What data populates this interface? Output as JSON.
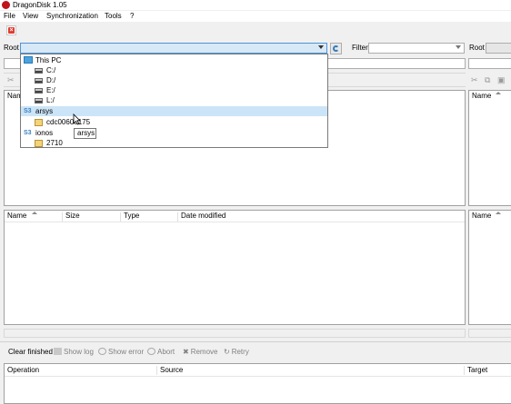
{
  "window": {
    "title": "DragonDisk 1.05"
  },
  "menu": [
    "File",
    "View",
    "Synchronization",
    "Tools",
    "?"
  ],
  "left_pane": {
    "root_label": "Root",
    "filter_label": "Filter",
    "header_top": {
      "name": "Name"
    },
    "columns": [
      "Name",
      "Size",
      "Type",
      "Date modified"
    ]
  },
  "right_pane": {
    "root_label": "Root",
    "header_top": {
      "name": "Name"
    },
    "header_bottom": {
      "name": "Name"
    }
  },
  "dropdown": {
    "items": [
      {
        "label": "This PC",
        "icon": "computer-icon",
        "level": 0
      },
      {
        "label": "C:/",
        "icon": "drive-icon",
        "level": 1
      },
      {
        "label": "D:/",
        "icon": "drive-icon",
        "level": 1
      },
      {
        "label": "E:/",
        "icon": "drive-icon",
        "level": 1
      },
      {
        "label": "L:/",
        "icon": "drive-icon",
        "level": 1
      },
      {
        "label": "arsys",
        "icon": "s3-icon",
        "badge": "S3",
        "level": 0,
        "highlighted": true
      },
      {
        "label": "cdc00606175",
        "icon": "bucket-icon",
        "level": 1
      },
      {
        "label": "ionos",
        "icon": "s3-icon",
        "badge": "S3",
        "level": 0
      },
      {
        "label": "2710",
        "icon": "bucket-icon",
        "level": 1
      }
    ],
    "tooltip": "arsys"
  },
  "transfer_toolbar": {
    "clear_finished": "Clear finished",
    "show_log": "Show log",
    "show_error": "Show error",
    "abort": "Abort",
    "remove": "Remove",
    "retry": "Retry"
  },
  "transfer_table": {
    "columns": [
      "Operation",
      "Source",
      "Target"
    ]
  },
  "colors": {
    "highlight": "#cce4f7",
    "accent": "#2f7bbf",
    "s3": "#3a7fc1"
  }
}
